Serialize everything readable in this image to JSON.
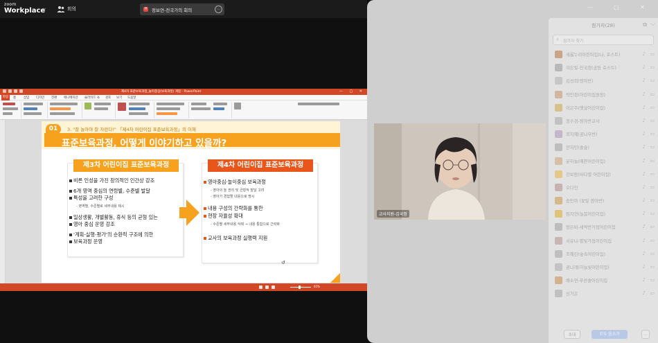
{
  "app": {
    "brand_line1": "zoom",
    "brand_line2": "Workplace"
  },
  "topbar": {
    "meeting_label": "회의",
    "tab_rec": "H",
    "tab_title": "정보연-전국가의 회의",
    "tab_more": "⋯"
  },
  "ppt": {
    "doc_title": "제4차 표준보육과정_놀이중심(보육과정) 개정 - PowerPoint",
    "window_controls": "— ▢ ✕",
    "file_tab": "파일",
    "menus": [
      "홈",
      "삽입",
      "디자인",
      "전환",
      "애니메이션",
      "슬라이드 쇼",
      "검토",
      "보기",
      "도움말"
    ],
    "zoom_pct": "65%"
  },
  "slide": {
    "number": "01",
    "subtitle": "3. \"잘 놀아야 잘 자란다!\" 「제4차 어린이집 표준보육과정」의 이해",
    "title": "표준보육과정, 어떻게 이야기하고 있을까?",
    "left_box": {
      "heading": "제3차 어린이집 표준보육과정",
      "bullets": [
        "비른 인성을 가진 창의적인 인간상 강조",
        "6개 영역 중심의 연령별, 수준별 발달",
        "특성을 고려한 구성",
        "- 영역별, 수준별로 세부내용 제시",
        "일상생활, 개별활동, 휴식 등의 균형 있는",
        "영아 중심 운영 강조",
        "'계획-실행-평가'의 순환적 구조에 의한",
        "보육과정 운영"
      ]
    },
    "right_box": {
      "heading": "제4차 어린이집 표준보육과정",
      "bullets": [
        "영아중심·놀이중심 보육과정",
        "- 영아의 놀 권리 및 균형적 발달 고려",
        "- 영아가 경험할 내용으로 명시",
        "내용 구성의 간략화를 통한",
        "현장 자율성 확대",
        "- 수준별 세부내용 삭제 → 내용 통합으로 간략화",
        "교사의 보육과정 실행력 지원"
      ]
    },
    "cursor": "↺"
  },
  "video": {
    "name": "교사지원-김국정"
  },
  "participants": {
    "title": "참가자(28)",
    "search_placeholder": "참가자 찾기",
    "rows": [
      {
        "name": "새롬누리어린이집(나, 호스트)",
        "color": "#c9a58a"
      },
      {
        "name": "하은빛-진국정(공동 호스트)",
        "color": "#b9b9b9"
      },
      {
        "name": "김선희(영아반)",
        "color": "#c6c6c6"
      },
      {
        "name": "박민정(어린이집원장)",
        "color": "#d2b6a0"
      },
      {
        "name": "이은주(햇살어린이집)",
        "color": "#d7c08b"
      },
      {
        "name": "정수경-영아반교사",
        "color": "#c2c2c2"
      },
      {
        "name": "최지혜(꿈나무반)",
        "color": "#c4b8c8"
      },
      {
        "name": "한지민(솔숲)",
        "color": "#bdbdbd"
      },
      {
        "name": "윤하늘(예쁜어린이집)",
        "color": "#d3c0a6"
      },
      {
        "name": "강보람(바다별 어린이집)",
        "color": "#e4c889"
      },
      {
        "name": "오다인",
        "color": "#c7b2b2"
      },
      {
        "name": "송민아 (꽃잎 영아반)",
        "color": "#d5b98c"
      },
      {
        "name": "임지현(늘봄어린이집)",
        "color": "#e0c27a"
      },
      {
        "name": "장은비-새싹반가정어린이집",
        "color": "#bdbdbd"
      },
      {
        "name": "서유나-별빛가정어린이집",
        "color": "#c8b5b5"
      },
      {
        "name": "조혜린(숲속어린이집)",
        "color": "#bfbfbf"
      },
      {
        "name": "권나래(하늘빛어린이집)",
        "color": "#c4c4c4"
      },
      {
        "name": "배소연-푸른솔어린이집",
        "color": "#d3b38e"
      },
      {
        "name": "신가은",
        "color": "#c0c0c0"
      }
    ],
    "invite": "초대",
    "mute_all": "모두 음소거",
    "more": "⋯"
  }
}
